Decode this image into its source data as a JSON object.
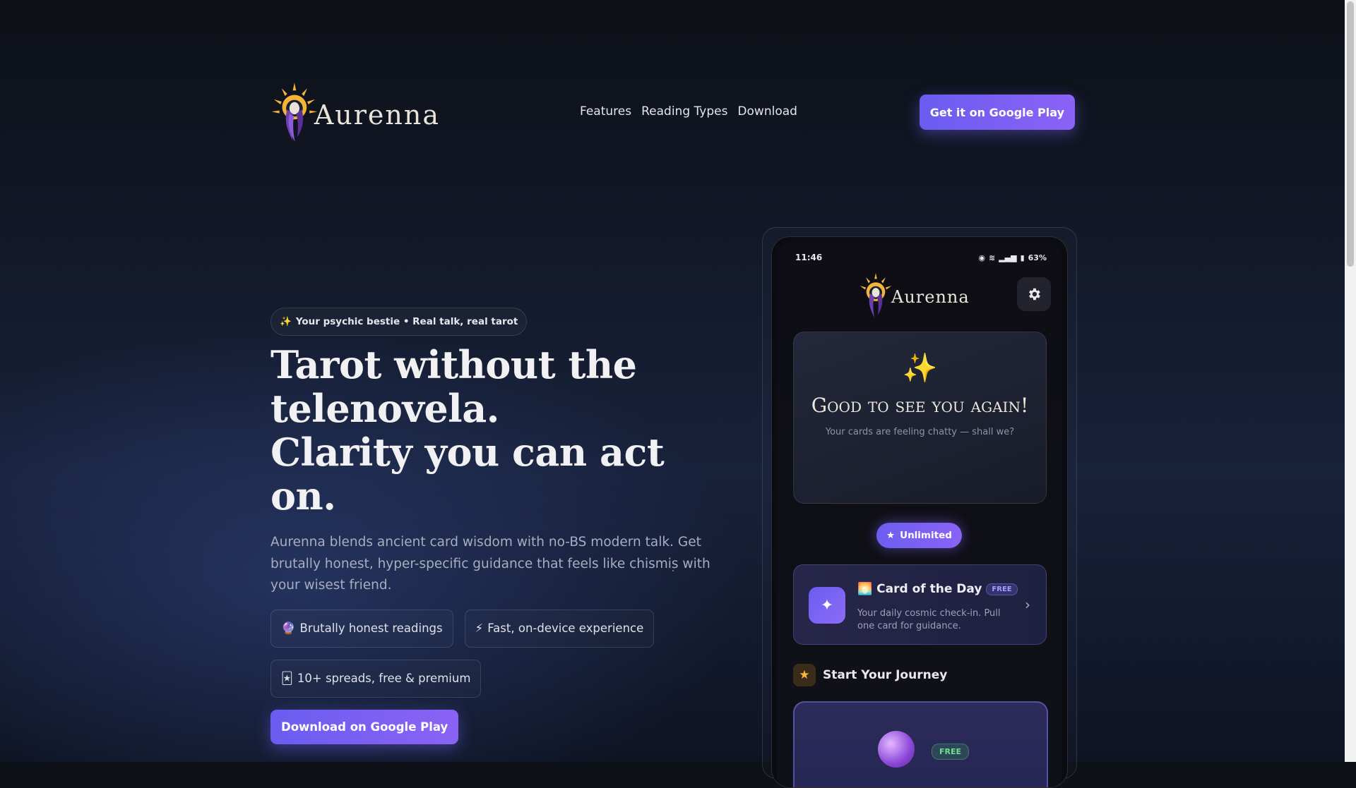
{
  "brand": {
    "name": "Aurenna"
  },
  "nav": {
    "links": [
      "Features",
      "Reading Types",
      "Download"
    ],
    "cta_label": "Get it on Google Play"
  },
  "hero": {
    "pill_icon": "✨",
    "pill_text": "Your psychic bestie • Real talk, real tarot",
    "title_line1": "Tarot without the",
    "title_line2": "telenovela.",
    "title_line3": "Clarity you can act on.",
    "description": "Aurenna blends ancient card wisdom with no-BS modern talk. Get brutally honest, hyper-specific guidance that feels like chismis with your wisest friend.",
    "chips": [
      {
        "icon": "🔮",
        "label": "Brutally honest readings"
      },
      {
        "icon": "⚡",
        "label": "Fast, on-device experience"
      },
      {
        "icon": "🃏",
        "label": "10+ spreads, free & premium"
      }
    ],
    "cta_label": "Download on Google Play"
  },
  "phone": {
    "status_time": "11:46",
    "battery": "63%",
    "app_name": "Aurenna",
    "welcome": {
      "icon": "✨",
      "title": "Good to see you again!",
      "subtitle": "Your cards are feeling chatty — shall we?"
    },
    "unlimited_label": "Unlimited",
    "card_of_day": {
      "emoji": "🌅",
      "title": "Card of the Day",
      "badge": "FREE",
      "description": "Your daily cosmic check-in. Pull one card for guidance."
    },
    "journey": {
      "title": "Start Your Journey",
      "badge": "FREE"
    }
  },
  "colors": {
    "accent": "#7b60f3",
    "gold": "#f4b43a",
    "background": "#121828"
  },
  "icons": [
    "sun-goddess-logo-icon",
    "gear-icon",
    "sparkle-icon",
    "star-icon",
    "chevron-right-icon",
    "crystal-orb-icon"
  ]
}
